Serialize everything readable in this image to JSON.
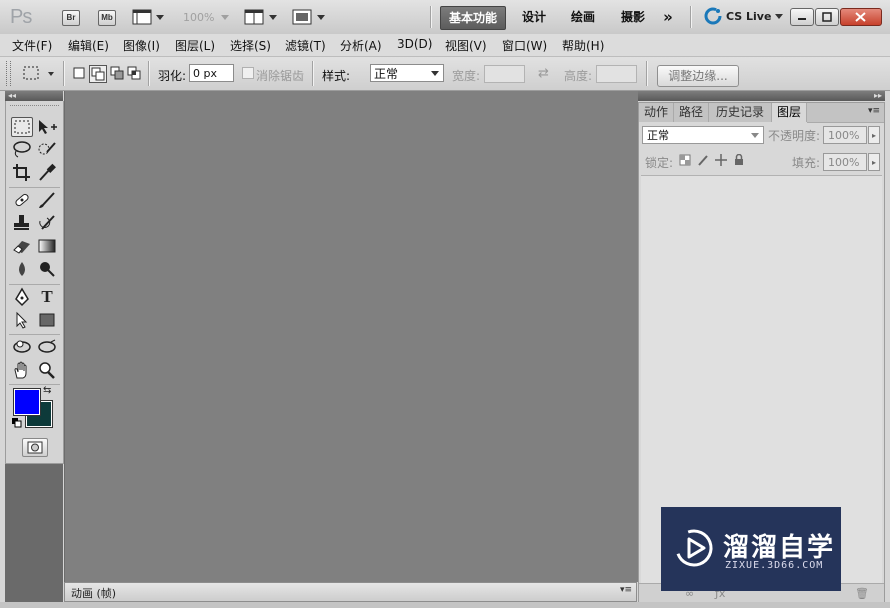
{
  "app": {
    "logo": "Ps",
    "bridge_label": "Br",
    "minibridge_label": "Mb",
    "zoom": "100%",
    "workspaces": [
      "基本功能",
      "设计",
      "绘画",
      "摄影"
    ],
    "active_workspace": "基本功能",
    "cs_live": "CS Live"
  },
  "menu": [
    "文件(F)",
    "编辑(E)",
    "图像(I)",
    "图层(L)",
    "选择(S)",
    "滤镜(T)",
    "分析(A)",
    "3D(D)",
    "视图(V)",
    "窗口(W)",
    "帮助(H)"
  ],
  "options": {
    "feather_label": "羽化:",
    "feather_value": "0 px",
    "antialias_label": "消除锯齿",
    "style_label": "样式:",
    "style_value": "正常",
    "width_label": "宽度:",
    "height_label": "高度:",
    "refine_edge": "调整边缘..."
  },
  "colors": {
    "foreground": "#0000ff",
    "background": "#0d3a3a"
  },
  "panel": {
    "tabs": [
      "动作",
      "路径",
      "历史记录",
      "图层"
    ],
    "active_tab": "图层",
    "blend_mode": "正常",
    "opacity_label": "不透明度:",
    "opacity_value": "100%",
    "lock_label": "锁定:",
    "fill_label": "填充:",
    "fill_value": "100%"
  },
  "animation_panel": {
    "title": "动画 (帧)"
  },
  "watermark": {
    "title": "溜溜自学",
    "subtitle": "ZIXUE.3D66.COM"
  }
}
